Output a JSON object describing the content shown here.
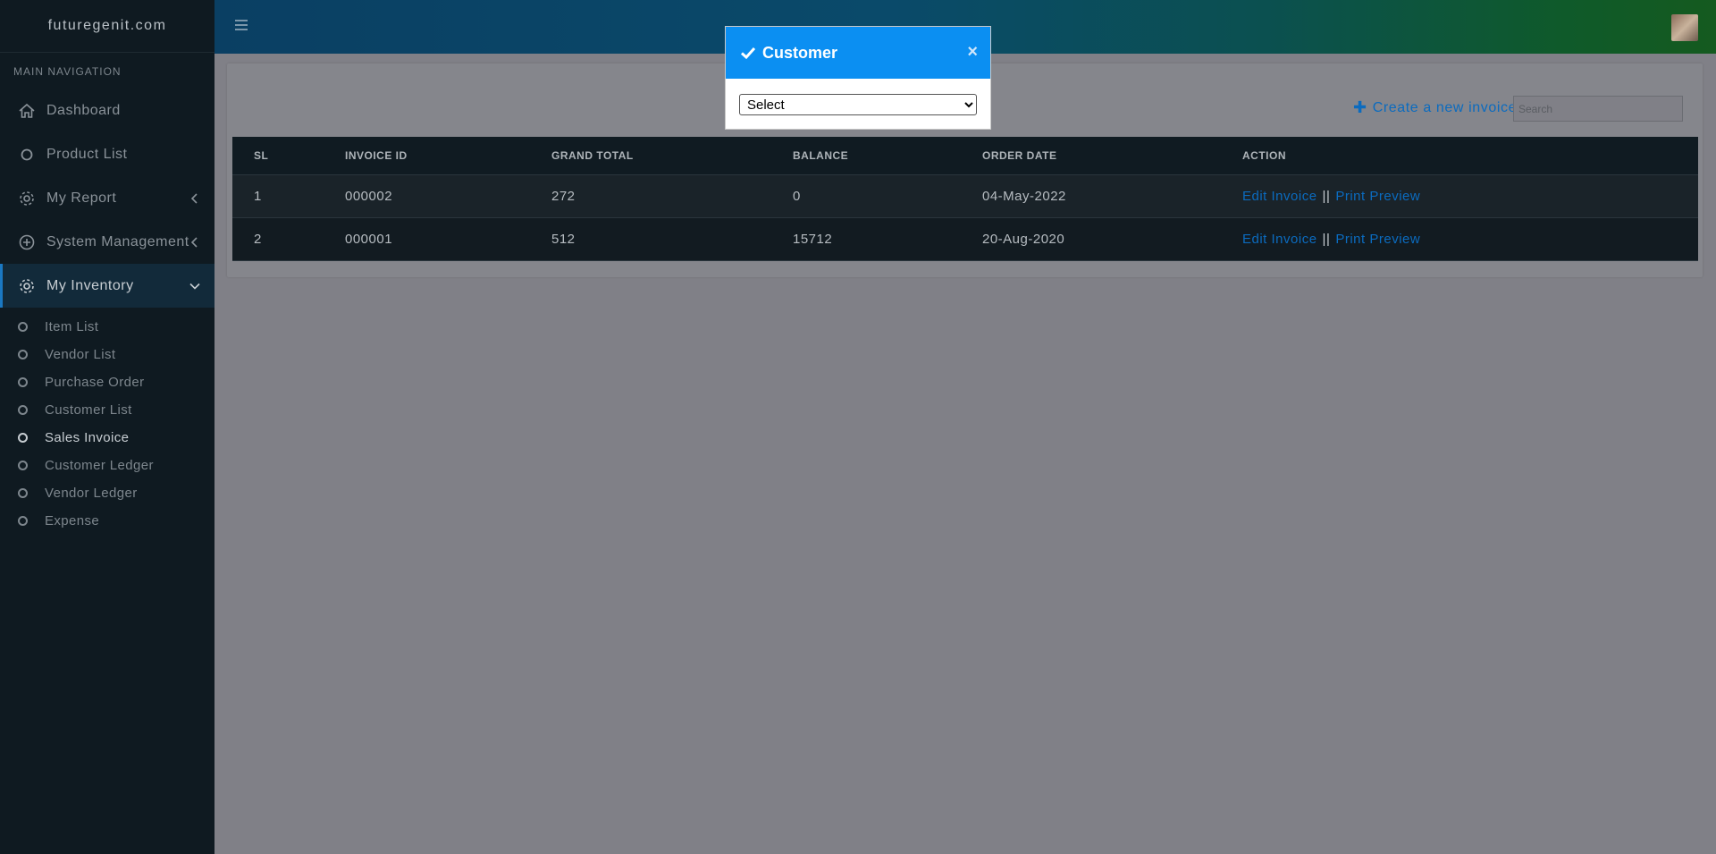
{
  "sidebar": {
    "brand": "futuregenit.com",
    "nav_header": "MAIN NAVIGATION",
    "items": [
      {
        "label": "Dashboard",
        "icon": "home-icon"
      },
      {
        "label": "Product List",
        "icon": "circle-icon"
      },
      {
        "label": "My Report",
        "icon": "gear-icon"
      },
      {
        "label": "System Management",
        "icon": "plus-circle-icon"
      },
      {
        "label": "My Inventory",
        "icon": "gear-icon"
      }
    ],
    "sub_items": [
      {
        "label": "Item List"
      },
      {
        "label": "Vendor List"
      },
      {
        "label": "Purchase Order"
      },
      {
        "label": "Customer List"
      },
      {
        "label": "Sales Invoice"
      },
      {
        "label": "Customer Ledger"
      },
      {
        "label": "Vendor Ledger"
      },
      {
        "label": "Expense"
      }
    ]
  },
  "toolbar": {
    "create_label": "Create a new invoice",
    "search_placeholder": "Search"
  },
  "table": {
    "headers": [
      "SL",
      "INVOICE ID",
      "GRAND TOTAL",
      "BALANCE",
      "ORDER DATE",
      "ACTION"
    ],
    "rows": [
      {
        "sl": "1",
        "invoice_id": "000002",
        "grand_total": "272",
        "balance": "0",
        "order_date": "04-May-2022"
      },
      {
        "sl": "2",
        "invoice_id": "000001",
        "grand_total": "512",
        "balance": "15712",
        "order_date": "20-Aug-2020"
      }
    ],
    "action_edit": "Edit Invoice",
    "action_sep": "||",
    "action_print": "Print Preview"
  },
  "modal": {
    "title": "Customer",
    "close": "×",
    "select_value": "Select"
  },
  "colors": {
    "accent": "#0b8ff2",
    "link": "#0b6bbf",
    "sidebar_bg": "#0f1a21"
  }
}
